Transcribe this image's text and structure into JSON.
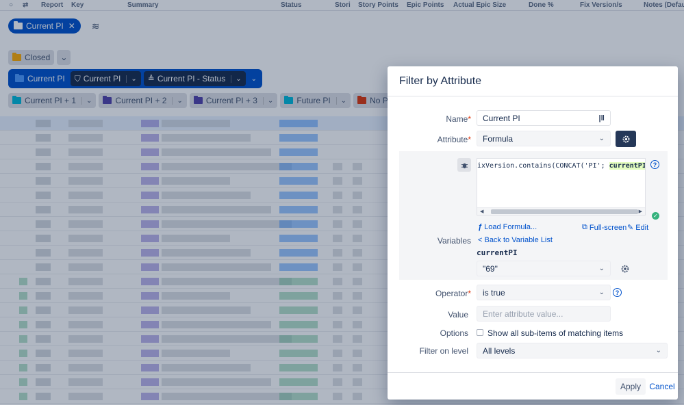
{
  "columns": [
    "Report",
    "Key",
    "Summary",
    "Status",
    "Stori",
    "Story Points",
    "Epic Points",
    "Actual Epic Size",
    "Done %",
    "Fix Version/s",
    "Notes (Defau"
  ],
  "chips": {
    "top": "Current PI",
    "closed": "Closed",
    "current": "Current PI",
    "filter_current": "Current PI",
    "filter_status": "Current PI - Status",
    "row": [
      "Current PI + 1",
      "Current PI + 2",
      "Current PI + 3",
      "Future PI",
      "No PI/MR"
    ]
  },
  "colors": {
    "blue": "#0052cc",
    "dark": "#172b4d",
    "folder_purple": "#5243aa",
    "folder_orange": "#ff991f",
    "folder_teal": "#00b8d9",
    "folder_red": "#de350b",
    "folder_yellow": "#ffab00"
  },
  "dialog": {
    "title": "Filter by Attribute",
    "name_label": "Name",
    "name_value": "Current PI",
    "attribute_label": "Attribute",
    "attribute_value": "Formula",
    "formula_prefix": "ixVersion.contains(CONCAT('PI'; ",
    "formula_var": "currentPI",
    "formula_suffix": "))",
    "load_formula": "Load Formula...",
    "fullscreen": "Full-screen",
    "edit": "Edit",
    "variables_label": "Variables",
    "back_to_list": "< Back to Variable List",
    "variable_name": "currentPI",
    "variable_value": "\"69\"",
    "operator_label": "Operator",
    "operator_value": "is true",
    "value_label": "Value",
    "value_placeholder": "Enter attribute value...",
    "options_label": "Options",
    "options_checkbox": "Show all sub-items of matching items",
    "filter_level_label": "Filter on level",
    "filter_level_value": "All levels",
    "apply": "Apply",
    "cancel": "Cancel"
  }
}
